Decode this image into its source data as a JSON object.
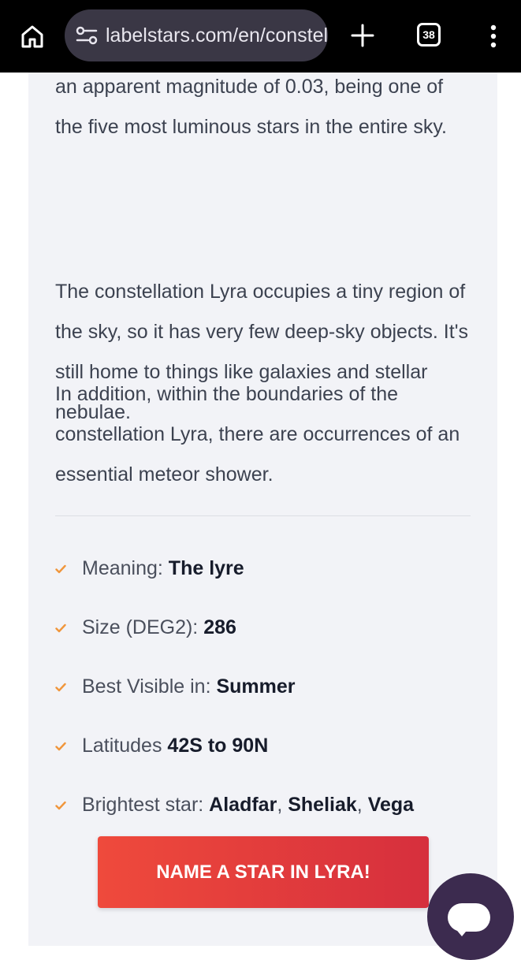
{
  "browser": {
    "url": "labelstars.com/en/constellations/lyra",
    "tab_count": "38",
    "icons": {
      "home": "home-icon",
      "site_settings": "tune-icon",
      "new_tab": "plus-icon",
      "tabs": "tab-switcher-icon",
      "menu": "kebab-menu-icon"
    }
  },
  "article": {
    "paragraphs": [
      "an apparent magnitude of 0.03, being one of the five most luminous stars in the entire sky.",
      "The constellation Lyra occupies a tiny region of the sky, so it has very few deep-sky objects. It's still home to things like galaxies and stellar nebulae.",
      "In addition, within the boundaries of the constellation Lyra, there are occurrences of an essential meteor shower."
    ]
  },
  "facts": [
    {
      "label": "Meaning: ",
      "value": "The lyre"
    },
    {
      "label": "Size (DEG2): ",
      "value": "286"
    },
    {
      "label": "Best Visible in: ",
      "value": "Summer"
    },
    {
      "label": "Latitudes ",
      "value": "42S to 90N"
    },
    {
      "label": "Brightest star: ",
      "stars": [
        "Aladfar",
        "Sheliak",
        "Vega"
      ],
      "separator": ", "
    }
  ],
  "cta": {
    "label": "NAME A STAR IN LYRA!"
  },
  "colors": {
    "accent": "#f0963c",
    "cta_start": "#ef4a3c",
    "cta_end": "#d62f3d",
    "chat": "#3c2b4f"
  }
}
